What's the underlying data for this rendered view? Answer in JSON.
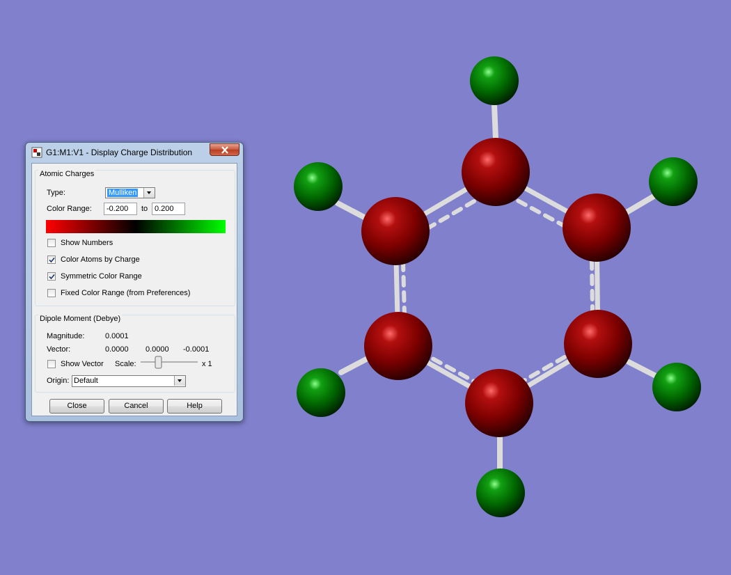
{
  "dialog": {
    "title": "G1:M1:V1 - Display Charge Distribution",
    "atomic_charges": {
      "group_title": "Atomic Charges",
      "type_label": "Type:",
      "type_value": "Mulliken",
      "color_range_label": "Color Range:",
      "range_min": "-0.200",
      "range_to": "to",
      "range_max": "0.200",
      "checkboxes": [
        {
          "label": "Show Numbers",
          "checked": false
        },
        {
          "label": "Color Atoms by Charge",
          "checked": true
        },
        {
          "label": "Symmetric Color Range",
          "checked": true
        },
        {
          "label": "Fixed Color Range (from Preferences)",
          "checked": false
        }
      ]
    },
    "dipole": {
      "group_title": "Dipole Moment (Debye)",
      "magnitude_label": "Magnitude:",
      "magnitude_value": "0.0001",
      "vector_label": "Vector:",
      "vector_x": "0.0000",
      "vector_y": "0.0000",
      "vector_z": "-0.0001",
      "show_vector_label": "Show Vector",
      "show_vector_checked": false,
      "scale_label": "Scale:",
      "scale_value": "x 1",
      "origin_label": "Origin:",
      "origin_value": "Default"
    },
    "buttons": {
      "close": "Close",
      "cancel": "Cancel",
      "help": "Help"
    }
  },
  "colors": {
    "background": "#8080cd",
    "carbon_atom": "#8b0000",
    "hydrogen_atom": "#0a7a0a",
    "bond": "#dcdcdc"
  }
}
